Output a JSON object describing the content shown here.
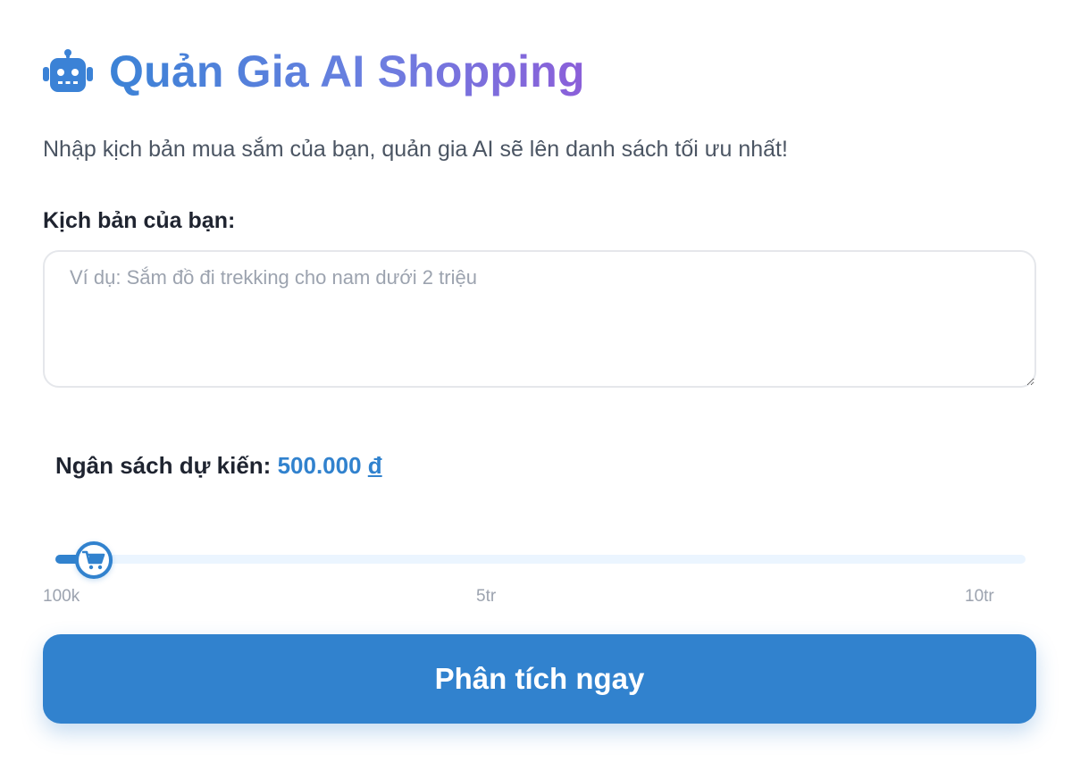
{
  "header": {
    "icon": "robot-icon",
    "title": "Quản Gia AI Shopping"
  },
  "subtitle": "Nhập kịch bản mua sắm của bạn, quản gia AI sẽ lên danh sách tối ưu nhất!",
  "scenario": {
    "label": "Kịch bản của bạn:",
    "placeholder": "Ví dụ: Sắm đồ đi trekking cho nam dưới 2 triệu",
    "value": ""
  },
  "budget": {
    "label": "Ngân sách dự kiến:",
    "value_display": "500.000",
    "currency": "đ",
    "slider": {
      "level_fraction": 0.04,
      "thumb_icon": "cart-icon",
      "ticks": {
        "min": "100k",
        "mid": "5tr",
        "max": "10tr"
      }
    }
  },
  "analyze_button": {
    "label": "Phân tích ngay"
  },
  "colors": {
    "accent": "#3182ce",
    "title_gradient_start": "#3b82d6",
    "title_gradient_end": "#8b5fd9",
    "track": "#ebf5ff",
    "muted_text": "#9ca3af"
  }
}
